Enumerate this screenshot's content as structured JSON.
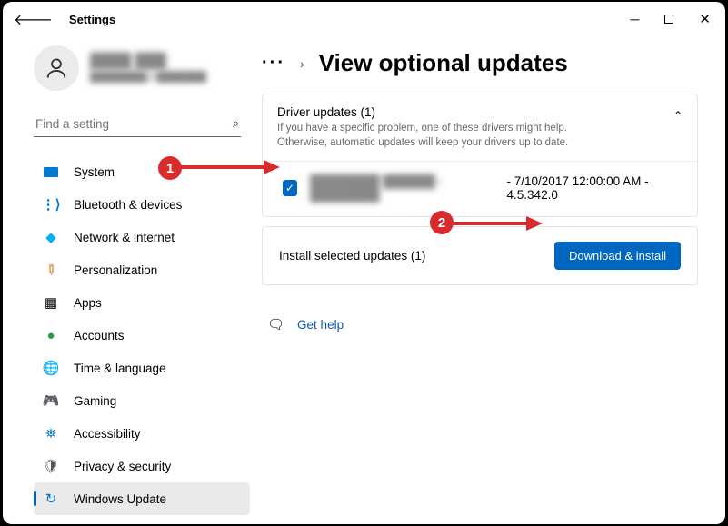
{
  "window": {
    "title": "Settings"
  },
  "account": {
    "name": "████ ███",
    "email": "████████@███████"
  },
  "search": {
    "placeholder": "Find a setting"
  },
  "sidebar": {
    "items": [
      {
        "label": "System"
      },
      {
        "label": "Bluetooth & devices"
      },
      {
        "label": "Network & internet"
      },
      {
        "label": "Personalization"
      },
      {
        "label": "Apps"
      },
      {
        "label": "Accounts"
      },
      {
        "label": "Time & language"
      },
      {
        "label": "Gaming"
      },
      {
        "label": "Accessibility"
      },
      {
        "label": "Privacy & security"
      },
      {
        "label": "Windows Update"
      }
    ]
  },
  "main": {
    "page_title": "View optional updates",
    "driver_section": {
      "title": "Driver updates (1)",
      "subtitle": "If you have a specific problem, one of these drivers might help. Otherwise, automatic updates will keep your drivers up to date.",
      "items": [
        {
          "name_blurred": "████████ ██████ - ████████",
          "meta": " - 7/10/2017 12:00:00 AM - 4.5.342.0"
        }
      ]
    },
    "install_bar": {
      "label": "Install selected updates (1)",
      "button": "Download & install"
    },
    "help": {
      "label": "Get help"
    }
  },
  "annotations": {
    "step1": "1",
    "step2": "2"
  }
}
